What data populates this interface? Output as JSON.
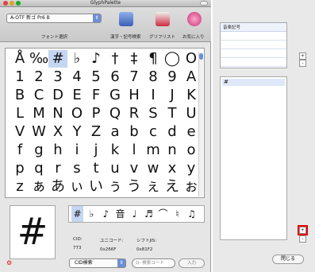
{
  "window": {
    "title": "GlyphPalette"
  },
  "toolbar": {
    "font_value": "A-OTF 新ゴ Pr6 B",
    "font_label": "フォント選択",
    "buttons": [
      {
        "label": "漢字・記号検索",
        "icon": "kanji-search-icon",
        "color": "#3a5fb8"
      },
      {
        "label": "グリフリスト",
        "icon": "glyph-list-icon",
        "color": "#cc2b3d"
      },
      {
        "label": "お気に入り",
        "icon": "favorites-icon",
        "color": "#cf2f78"
      }
    ]
  },
  "grid": {
    "rows": [
      [
        "Å",
        "‰",
        "#",
        "♭",
        "♪",
        "†",
        "‡",
        "¶",
        "◯",
        "O"
      ],
      [
        "1",
        "2",
        "3",
        "4",
        "5",
        "6",
        "7",
        "8",
        "9",
        "A"
      ],
      [
        "B",
        "C",
        "D",
        "E",
        "F",
        "G",
        "H",
        "I",
        "J",
        "K"
      ],
      [
        "L",
        "M",
        "N",
        "O",
        "P",
        "Q",
        "R",
        "S",
        "T",
        "U"
      ],
      [
        "V",
        "W",
        "X",
        "Y",
        "Z",
        "a",
        "b",
        "c",
        "d",
        "e"
      ],
      [
        "f",
        "g",
        "h",
        "i",
        "j",
        "k",
        "l",
        "m",
        "n",
        "o"
      ],
      [
        "p",
        "q",
        "r",
        "s",
        "t",
        "u",
        "v",
        "w",
        "x",
        "y"
      ],
      [
        "z",
        "ぁ",
        "あ",
        "ぃ",
        "い",
        "ぅ",
        "う",
        "ぇ",
        "え",
        "ぉ"
      ]
    ],
    "selected_row": 0,
    "selected_col": 2
  },
  "preview": {
    "glyph": "#"
  },
  "strip": {
    "glyphs": [
      "#",
      "♭",
      "♪",
      "音",
      "♩",
      "♬",
      "⌒",
      "♮",
      "♫"
    ],
    "selected": 0
  },
  "info": {
    "cid_label": "CID:",
    "cid_value": "773",
    "unicode_label": "ユニコード:",
    "unicode_value": "0x266F",
    "sjis_label": "シフトJIS:",
    "sjis_value": "0x81F2"
  },
  "bottom": {
    "search_mode": "CID検索",
    "search_placeholder": "Q- 検索コード",
    "enter_label": "入力"
  },
  "side": {
    "list1_header": "音楽記号",
    "list2_items": [
      "#"
    ],
    "plus": "+",
    "minus": "-",
    "close_label": "閉じる"
  },
  "colors": {
    "accent": "#6d8fd6",
    "highlight": "#e00000"
  }
}
